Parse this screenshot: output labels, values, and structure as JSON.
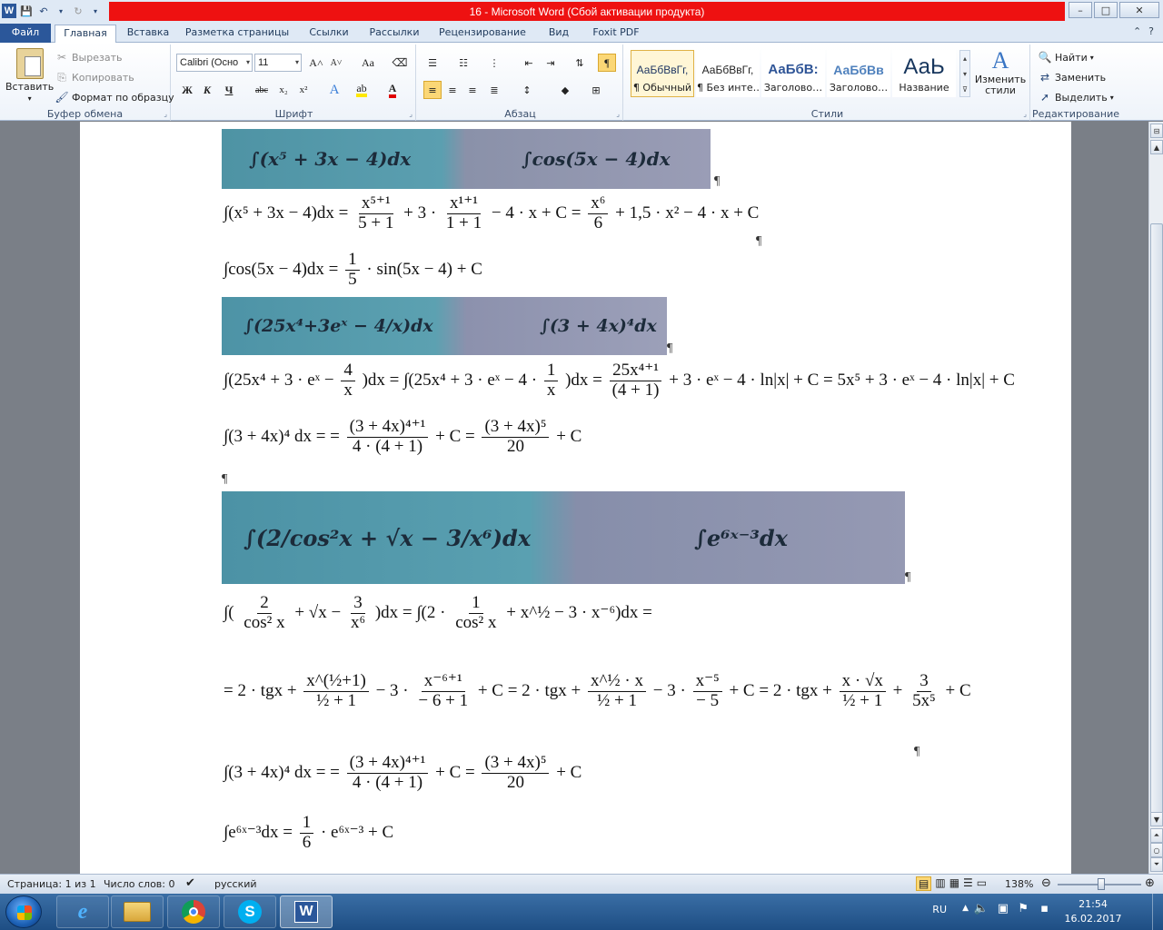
{
  "title": {
    "text": "16  -  Microsoft Word (Сбой активации продукта)"
  },
  "window_controls": {
    "minimize": "–",
    "maximize": "□",
    "close": "✕"
  },
  "tabs": [
    {
      "label": "Файл",
      "active": false
    },
    {
      "label": "Главная",
      "active": true
    },
    {
      "label": "Вставка",
      "active": false
    },
    {
      "label": "Разметка страницы",
      "active": false
    },
    {
      "label": "Ссылки",
      "active": false
    },
    {
      "label": "Рассылки",
      "active": false
    },
    {
      "label": "Рецензирование",
      "active": false
    },
    {
      "label": "Вид",
      "active": false
    },
    {
      "label": "Foxit PDF",
      "active": false
    }
  ],
  "clipboard": {
    "paste": "Вставить",
    "cut": "Вырезать",
    "copy": "Копировать",
    "format_painter": "Формат по образцу",
    "group_label": "Буфер обмена"
  },
  "font": {
    "name": "Calibri (Осно",
    "size": "11",
    "group_label": "Шрифт",
    "bold": "Ж",
    "italic": "К",
    "underline": "Ч",
    "strike": "abc",
    "subscript": "x₂",
    "superscript": "x²",
    "grow": "A˄",
    "shrink": "A˅",
    "case": "Aa"
  },
  "paragraph": {
    "group_label": "Абзац",
    "pilcrow": "¶"
  },
  "styles": {
    "group_label": "Стили",
    "change_label": "Изменить стили",
    "items": [
      {
        "sample": "АаБбВвГг,",
        "name": "¶ Обычный",
        "selected": true
      },
      {
        "sample": "АаБбВвГг,",
        "name": "¶ Без инте…",
        "selected": false
      },
      {
        "sample": "АаБбВ:",
        "name": "Заголово…",
        "selected": false
      },
      {
        "sample": "АаБбВв",
        "name": "Заголово…",
        "selected": false
      },
      {
        "sample": "АаЬ",
        "name": "Название",
        "selected": false
      }
    ]
  },
  "editing": {
    "group_label": "Редактирование",
    "find": "Найти",
    "replace": "Заменить",
    "select": "Выделить"
  },
  "document": {
    "pilcrow": "¶",
    "photos": [
      {
        "left": "∫(x⁵ + 3x − 4)dx",
        "right": "∫cos(5x − 4)dx"
      },
      {
        "left": "∫(25x⁴+3eˣ − 4/x)dx",
        "right": "∫(3 + 4x)⁴dx"
      },
      {
        "left": "∫(2/cos²x + √x − 3/x⁶)dx",
        "right": "∫e⁶ˣ⁻³dx"
      }
    ],
    "equations": {
      "eq1": {
        "lhs": "∫(x⁵ + 3x − 4)dx =",
        "f1n": "x⁵⁺¹",
        "f1d": "5 + 1",
        "m1": "+ 3 ·",
        "f2n": "x¹⁺¹",
        "f2d": "1 + 1",
        "m2": "− 4 · x + C =",
        "f3n": "x⁶",
        "f3d": "6",
        "tail": "+ 1,5 · x² − 4 · x + C"
      },
      "eq2": {
        "lhs": "∫cos(5x − 4)dx =",
        "fn": "1",
        "fd": "5",
        "tail": "· sin(5x − 4) + C"
      },
      "eq3": {
        "lhs": "∫(25x⁴ + 3 · eˣ −",
        "f1n": "4",
        "f1d": "x",
        "m1": ")dx = ∫(25x⁴ + 3 · eˣ − 4 ·",
        "f2n": "1",
        "f2d": "x",
        "m2": ")dx =",
        "f3n": "25x⁴⁺¹",
        "f3d": "(4 + 1)",
        "tail": "+ 3 · eˣ − 4 · ln|x| + C = 5x⁵ + 3 · eˣ − 4 · ln|x| + C"
      },
      "eq4": {
        "lhs": "∫(3 + 4x)⁴ dx = =",
        "f1n": "(3 + 4x)⁴⁺¹",
        "f1d": "4 · (4 + 1)",
        "m1": "+ C =",
        "f2n": "(3 + 4x)⁵",
        "f2d": "20",
        "tail": "+ C"
      },
      "eq5": {
        "lhs": "∫(",
        "f1n": "2",
        "f1d": "cos² x",
        "m1": "+ √x −",
        "f2n": "3",
        "f2d": "x⁶",
        "m2": ")dx = ∫(2 ·",
        "f3n": "1",
        "f3d": "cos² x",
        "tail": "+ x^½ − 3 · x⁻⁶)dx ="
      },
      "eq6": {
        "lhs": "= 2 · tgx +",
        "f1n": "x^(½+1)",
        "f1d": "½ + 1",
        "m1": "− 3 ·",
        "f2n": "x⁻⁶⁺¹",
        "f2d": "− 6 + 1",
        "m2": "+ C = 2 · tgx +",
        "f3n": "x^½ · x",
        "f3d": "½ + 1",
        "m3": "− 3 ·",
        "f4n": "x⁻⁵",
        "f4d": "− 5",
        "m4": "+ C = 2 · tgx +",
        "f5n": "x · √x",
        "f5d": "½ + 1",
        "m5": "+",
        "f6n": "3",
        "f6d": "5x⁵",
        "tail": "+ C"
      },
      "eq7": {
        "lhs": "∫(3 + 4x)⁴ dx = =",
        "f1n": "(3 + 4x)⁴⁺¹",
        "f1d": "4 · (4 + 1)",
        "m1": "+ C =",
        "f2n": "(3 + 4x)⁵",
        "f2d": "20",
        "tail": "+ C"
      },
      "eq8": {
        "lhs": "∫e⁶ˣ⁻³dx =",
        "fn": "1",
        "fd": "6",
        "tail": "· e⁶ˣ⁻³ + C"
      }
    }
  },
  "status": {
    "page": "Страница: 1 из 1",
    "words": "Число слов: 0",
    "language": "русский",
    "zoom": "138%"
  },
  "taskbar": {
    "lang": "RU",
    "time": "21:54",
    "date": "16.02.2017"
  },
  "colors": {
    "title_bar_warning": "#ee1111",
    "file_tab": "#2b579a",
    "taskbar": "#2a5c94"
  }
}
